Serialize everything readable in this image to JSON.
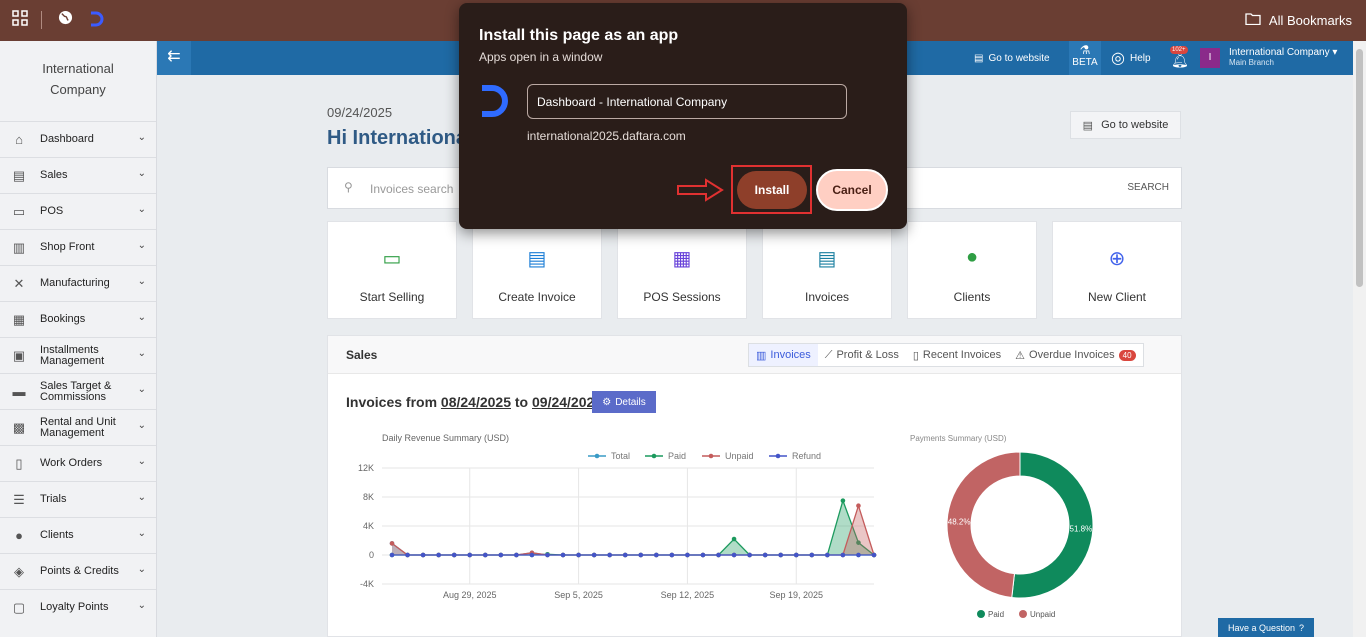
{
  "browser": {
    "bookmarks_label": "All Bookmarks",
    "icons": [
      "apps-grid-icon",
      "globe-icon",
      "daftara-logo-icon",
      "folder-icon"
    ]
  },
  "sidebar": {
    "company": "International Company",
    "items": [
      {
        "label": "Dashboard",
        "icon": "home-icon"
      },
      {
        "label": "Sales",
        "icon": "document-icon"
      },
      {
        "label": "POS",
        "icon": "pos-icon"
      },
      {
        "label": "Shop Front",
        "icon": "shop-icon"
      },
      {
        "label": "Manufacturing",
        "icon": "tools-icon"
      },
      {
        "label": "Bookings",
        "icon": "calendar-icon"
      },
      {
        "label": "Installments Management",
        "icon": "installments-icon"
      },
      {
        "label": "Sales Target & Commissions",
        "icon": "money-icon"
      },
      {
        "label": "Rental and Unit Management",
        "icon": "rental-icon"
      },
      {
        "label": "Work Orders",
        "icon": "clipboard-icon"
      },
      {
        "label": "Trials",
        "icon": "clipboard-list-icon"
      },
      {
        "label": "Clients",
        "icon": "user-icon"
      },
      {
        "label": "Points & Credits",
        "icon": "layers-icon"
      },
      {
        "label": "Loyalty Points",
        "icon": "gift-icon"
      }
    ]
  },
  "appbar": {
    "goto_website": "Go to website",
    "beta": "BETA",
    "help": "Help",
    "notif_count": "102+",
    "avatar_letter": "I",
    "company": "International Company",
    "branch": "Main Branch"
  },
  "main": {
    "date": "09/24/2025",
    "greeting": "Hi International",
    "goto_website": "Go to website",
    "search_placeholder": "Invoices search",
    "search_button": "SEARCH",
    "tiles": [
      {
        "label": "Start Selling",
        "icon": "register-icon",
        "color": "#2f9e44"
      },
      {
        "label": "Create Invoice",
        "icon": "invoice-add-icon",
        "color": "#1c7ed6"
      },
      {
        "label": "POS Sessions",
        "icon": "calculator-icon",
        "color": "#6741d9"
      },
      {
        "label": "Invoices",
        "icon": "invoice-icon",
        "color": "#1a7fa0"
      },
      {
        "label": "Clients",
        "icon": "client-icon",
        "color": "#2f9e44"
      },
      {
        "label": "New Client",
        "icon": "user-add-icon",
        "color": "#4263eb"
      }
    ]
  },
  "sales": {
    "title": "Sales",
    "tabs": [
      {
        "label": "Invoices",
        "icon": "bar-chart-icon"
      },
      {
        "label": "Profit & Loss",
        "icon": "line-chart-icon"
      },
      {
        "label": "Recent Invoices",
        "icon": "file-icon"
      },
      {
        "label": "Overdue Invoices",
        "icon": "warning-icon"
      }
    ],
    "overdue_count": "40",
    "invoices_from": "Invoices from",
    "from_date": "08/24/2025",
    "to_word": "to",
    "to_date": "09/24/2025",
    "details": "Details"
  },
  "dialog": {
    "title": "Install this page as an app",
    "subtitle": "Apps open in a window",
    "name_value": "Dashboard - International Company",
    "host": "international2025.daftara.com",
    "install": "Install",
    "cancel": "Cancel"
  },
  "have_question": "Have a Question",
  "chart_data": [
    {
      "type": "area",
      "title": "Daily Revenue Summary (USD)",
      "x_ticks": [
        "Aug 29, 2025",
        "Sep 5, 2025",
        "Sep 12, 2025",
        "Sep 19, 2025"
      ],
      "y_ticks": [
        "12K",
        "8K",
        "4K",
        "0",
        "-4K"
      ],
      "ylim": [
        -4000,
        12000
      ],
      "x": [
        "Aug 24",
        "Aug 25",
        "Aug 26",
        "Aug 27",
        "Aug 28",
        "Aug 29",
        "Aug 30",
        "Aug 31",
        "Sep 1",
        "Sep 2",
        "Sep 3",
        "Sep 4",
        "Sep 5",
        "Sep 6",
        "Sep 7",
        "Sep 8",
        "Sep 9",
        "Sep 10",
        "Sep 11",
        "Sep 12",
        "Sep 13",
        "Sep 14",
        "Sep 15",
        "Sep 16",
        "Sep 17",
        "Sep 18",
        "Sep 19",
        "Sep 20",
        "Sep 21",
        "Sep 22",
        "Sep 23",
        "Sep 24"
      ],
      "series": [
        {
          "name": "Total",
          "color": "#3a9bc6",
          "values": [
            1600,
            0,
            0,
            0,
            0,
            0,
            0,
            0,
            0,
            300,
            0,
            0,
            0,
            0,
            0,
            0,
            0,
            0,
            0,
            0,
            0,
            0,
            0,
            0,
            0,
            0,
            0,
            0,
            0,
            0,
            0,
            0
          ]
        },
        {
          "name": "Paid",
          "color": "#1c9a5e",
          "values": [
            0,
            0,
            0,
            0,
            0,
            0,
            0,
            0,
            0,
            0,
            100,
            0,
            0,
            0,
            0,
            0,
            0,
            0,
            0,
            0,
            0,
            0,
            2200,
            0,
            0,
            0,
            0,
            0,
            0,
            7500,
            1700,
            0
          ]
        },
        {
          "name": "Unpaid",
          "color": "#c45c5c",
          "values": [
            1600,
            0,
            0,
            0,
            0,
            0,
            0,
            0,
            0,
            300,
            0,
            0,
            0,
            0,
            0,
            0,
            0,
            0,
            0,
            0,
            0,
            0,
            0,
            0,
            0,
            0,
            0,
            0,
            0,
            0,
            6800,
            0
          ]
        },
        {
          "name": "Refund",
          "color": "#4455c8",
          "values": [
            0,
            0,
            0,
            0,
            0,
            0,
            0,
            0,
            0,
            0,
            0,
            0,
            0,
            0,
            0,
            0,
            0,
            0,
            0,
            0,
            0,
            0,
            0,
            0,
            0,
            0,
            0,
            0,
            0,
            0,
            0,
            0
          ]
        }
      ]
    },
    {
      "type": "pie",
      "title": "Payments Summary (USD)",
      "slices": [
        {
          "label": "Paid",
          "value": 51.8,
          "color": "#0f8a5c"
        },
        {
          "label": "Unpaid",
          "value": 48.2,
          "color": "#c16464"
        }
      ],
      "labels": [
        "51.8%",
        "48.2%"
      ]
    }
  ]
}
